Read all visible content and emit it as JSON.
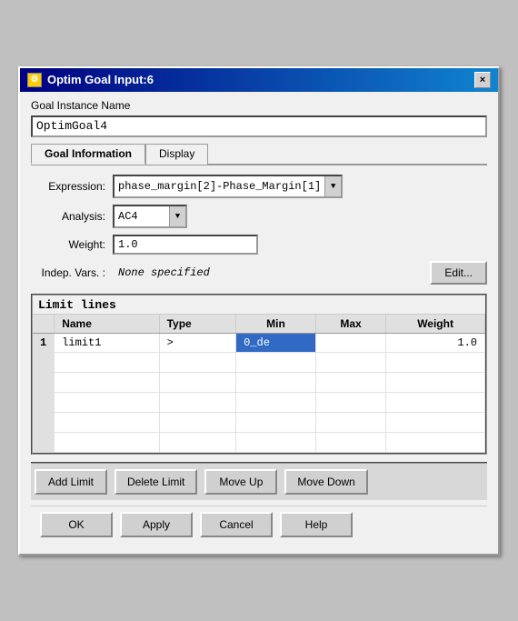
{
  "window": {
    "title": "Optim Goal Input:6",
    "close_label": "×"
  },
  "goal_instance": {
    "label": "Goal Instance Name",
    "value": "OptimGoal4"
  },
  "tabs": [
    {
      "label": "Goal Information",
      "active": true
    },
    {
      "label": "Display",
      "active": false
    }
  ],
  "form": {
    "expression_label": "Expression:",
    "expression_value": "phase_margin[2]-Phase_Margin[1]",
    "analysis_label": "Analysis:",
    "analysis_value": "AC4",
    "weight_label": "Weight:",
    "weight_value": "1.0",
    "indep_label": "Indep. Vars. :",
    "indep_value": "None specified",
    "edit_label": "Edit..."
  },
  "limit_lines": {
    "title": "Limit lines",
    "columns": [
      "Name",
      "Type",
      "Min",
      "Max",
      "Weight"
    ],
    "rows": [
      {
        "row_num": "1",
        "name": "limit1",
        "type": ">",
        "min": "0_de",
        "max": "",
        "weight": "1.0"
      }
    ]
  },
  "action_buttons": {
    "add_limit": "Add Limit",
    "delete_limit": "Delete Limit",
    "move_up": "Move Up",
    "move_down": "Move Down"
  },
  "footer_buttons": {
    "ok": "OK",
    "apply": "Apply",
    "cancel": "Cancel",
    "help": "Help"
  }
}
